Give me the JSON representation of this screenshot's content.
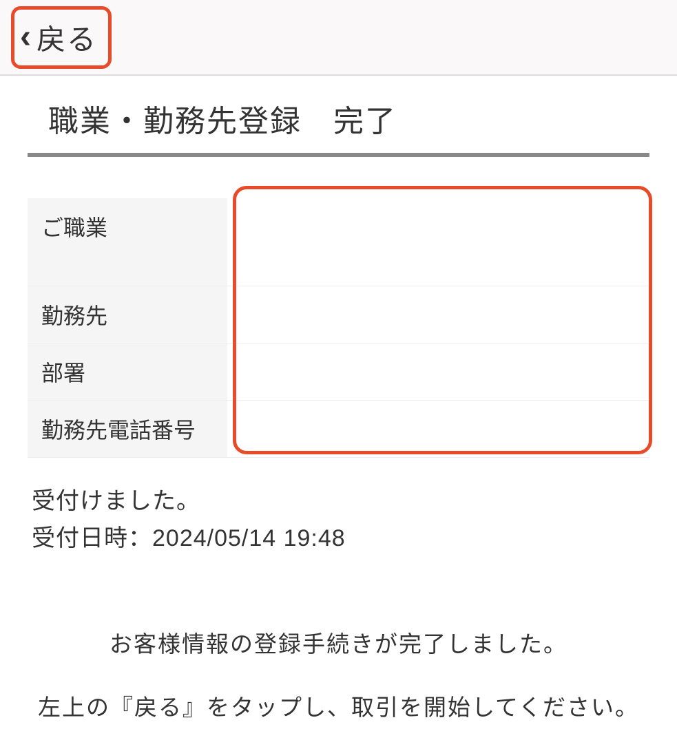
{
  "header": {
    "back_label": "戻る"
  },
  "page": {
    "title": "職業・勤務先登録　完了"
  },
  "form": {
    "rows": [
      {
        "label": "ご職業",
        "value": ""
      },
      {
        "label": "勤務先",
        "value": ""
      },
      {
        "label": "部署",
        "value": ""
      },
      {
        "label": "勤務先電話番号",
        "value": ""
      }
    ]
  },
  "status": {
    "accepted": "受付けました。",
    "datetime_label": "受付日時：",
    "datetime_value": "2024/05/14 19:48"
  },
  "info": {
    "line1": "お客様情報の登録手続きが完了しました。",
    "line2": "左上の『戻る』をタップし、取引を開始してください。"
  }
}
